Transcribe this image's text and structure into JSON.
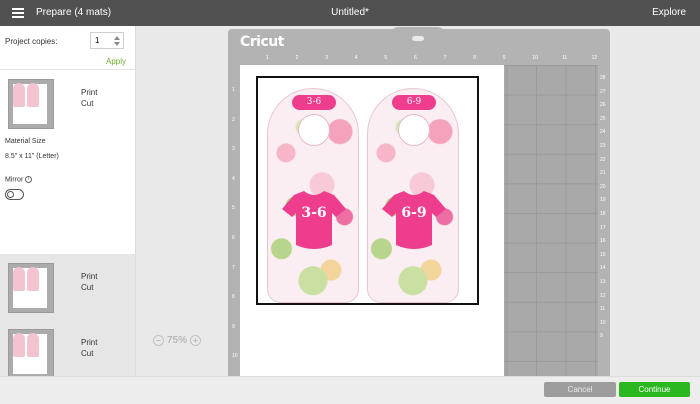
{
  "topbar": {
    "title": "Prepare (4 mats)",
    "document": "Untitled*",
    "explore": "Explore"
  },
  "sidebar": {
    "copies_label": "Project copies:",
    "copies_value": "1",
    "apply_label": "Apply",
    "mats": [
      {
        "label_1": "Print",
        "label_2": "Cut"
      },
      {
        "label_1": "Print",
        "label_2": "Cut"
      },
      {
        "label_1": "Print",
        "label_2": "Cut"
      }
    ],
    "material_size_label": "Material Size",
    "material_size_value": "8.5\" x 11\" (Letter)",
    "mirror_label": "Mirror",
    "mirror_enabled": false
  },
  "canvas": {
    "brand": "Cricut",
    "zoom": "75%",
    "ruler_top": [
      "1",
      "2",
      "3",
      "4",
      "5",
      "6",
      "7",
      "8",
      "9",
      "10",
      "11",
      "12"
    ],
    "ruler_left": [
      "1",
      "2",
      "3",
      "4",
      "5",
      "6",
      "7",
      "8",
      "9",
      "10"
    ],
    "ruler_right": [
      "28",
      "27",
      "26",
      "25",
      "24",
      "23",
      "22",
      "21",
      "20",
      "19",
      "18",
      "17",
      "16",
      "15",
      "14",
      "13",
      "12",
      "11",
      "10",
      "9"
    ],
    "tags": [
      {
        "size_small": "3-6",
        "size_large": "3-6"
      },
      {
        "size_small": "6-9",
        "size_large": "6-9"
      }
    ],
    "colors": {
      "tag_pink": "#ee3d8d",
      "mat_gray": "#b3b3b3"
    }
  },
  "footer": {
    "cancel": "Cancel",
    "continue": "Continue"
  }
}
